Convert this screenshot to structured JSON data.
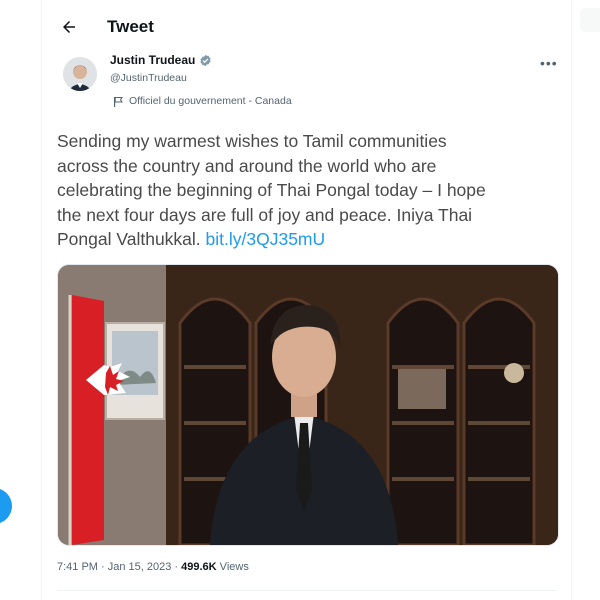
{
  "header": {
    "title": "Tweet",
    "back_icon": "arrow-left-icon"
  },
  "author": {
    "name": "Justin Trudeau",
    "handle": "@JustinTrudeau",
    "label": "Officiel du gouvernement - Canada",
    "verified": true
  },
  "tweet": {
    "text": "Sending my warmest wishes to Tamil communities\nacross the country and around the world who are\ncelebrating the beginning of Thai Pongal today – I hope\nthe next four days are full of joy and peace. Iniya Thai\nPongal Valthukkal. ",
    "link": "bit.ly/3QJ35mU"
  },
  "meta": {
    "time": "7:41 PM · Jan 15, 2023 · ",
    "views_count": "499.6K",
    "views_label": " Views"
  },
  "colors": {
    "accent": "#1d9bf0",
    "text_primary": "#0f1419",
    "text_secondary": "#536471"
  }
}
